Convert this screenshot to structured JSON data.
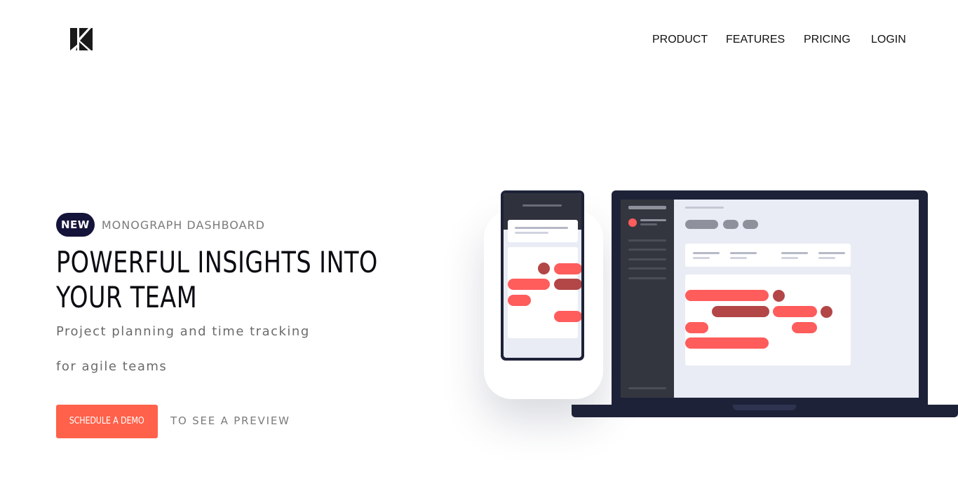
{
  "header": {
    "logo_icon": "monograph-k-logo",
    "nav": [
      {
        "label": "PRODUCT"
      },
      {
        "label": "FEATURES"
      },
      {
        "label": "PRICING"
      },
      {
        "label": "LOGIN"
      }
    ]
  },
  "hero": {
    "badge": "NEW",
    "eyebrow": "MONOGRAPH DASHBOARD",
    "headline_line1": "POWERFUL INSIGHTS INTO",
    "headline_line2": "YOUR TEAM",
    "sub_line1": "Project planning and time tracking",
    "sub_line2": "for agile teams",
    "cta_label": "SCHEDULE A DEMO",
    "preview_text": "TO SEE A PREVIEW"
  },
  "colors": {
    "accent": "#ff614a",
    "badge_bg": "#14133a",
    "bar_coral": "#ff5c5c",
    "bar_dark_red": "#b34646",
    "device_frame": "#1e2238"
  }
}
